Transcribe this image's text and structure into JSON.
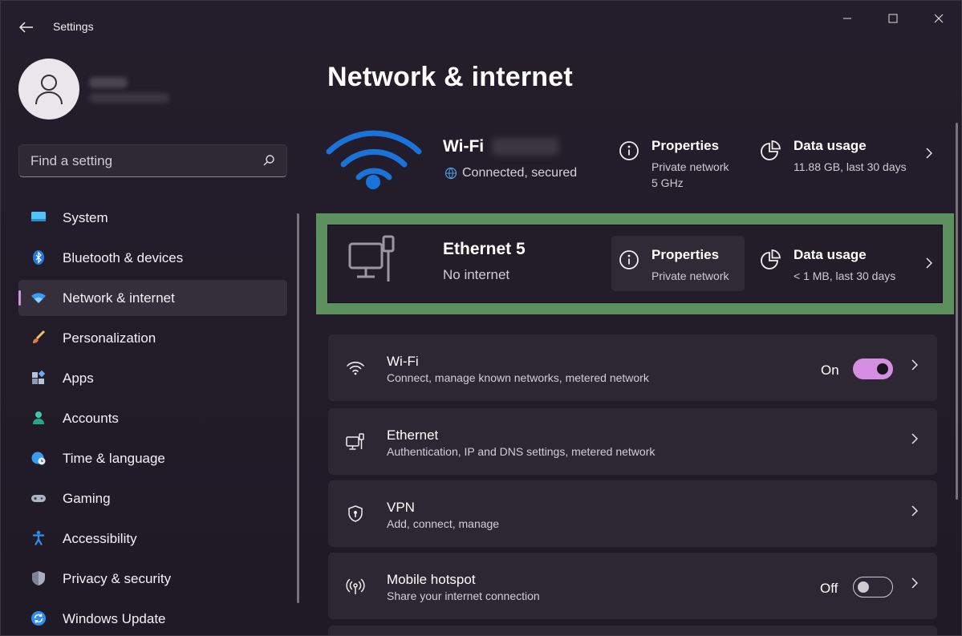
{
  "window": {
    "title": "Settings"
  },
  "sidebar": {
    "search_placeholder": "Find a setting",
    "items": [
      {
        "label": "System",
        "icon": "monitor-icon"
      },
      {
        "label": "Bluetooth & devices",
        "icon": "bluetooth-icon"
      },
      {
        "label": "Network & internet",
        "icon": "wifi-icon",
        "active": true
      },
      {
        "label": "Personalization",
        "icon": "brush-icon"
      },
      {
        "label": "Apps",
        "icon": "apps-icon"
      },
      {
        "label": "Accounts",
        "icon": "person-icon"
      },
      {
        "label": "Time & language",
        "icon": "globe-clock-icon"
      },
      {
        "label": "Gaming",
        "icon": "gamepad-icon"
      },
      {
        "label": "Accessibility",
        "icon": "accessibility-icon"
      },
      {
        "label": "Privacy & security",
        "icon": "shield-icon"
      },
      {
        "label": "Windows Update",
        "icon": "update-icon"
      }
    ]
  },
  "main": {
    "title": "Network & internet",
    "wifi": {
      "name": "Wi-Fi",
      "status": "Connected, secured",
      "properties_label": "Properties",
      "properties_sub1": "Private network",
      "properties_sub2": "5 GHz",
      "usage_label": "Data usage",
      "usage_sub": "11.88 GB, last 30 days"
    },
    "ethernet": {
      "name": "Ethernet 5",
      "status": "No internet",
      "properties_label": "Properties",
      "properties_sub": "Private network",
      "usage_label": "Data usage",
      "usage_sub": "< 1 MB, last 30 days"
    },
    "cards": [
      {
        "title": "Wi-Fi",
        "subtitle": "Connect, manage known networks, metered network",
        "toggle_label": "On",
        "toggle_state": "on"
      },
      {
        "title": "Ethernet",
        "subtitle": "Authentication, IP and DNS settings, metered network"
      },
      {
        "title": "VPN",
        "subtitle": "Add, connect, manage"
      },
      {
        "title": "Mobile hotspot",
        "subtitle": "Share your internet connection",
        "toggle_label": "Off",
        "toggle_state": "off"
      }
    ]
  },
  "colors": {
    "accent": "#d68ee3",
    "highlight_border": "#5e8f5e",
    "wifi_blue": "#1a73d9"
  }
}
